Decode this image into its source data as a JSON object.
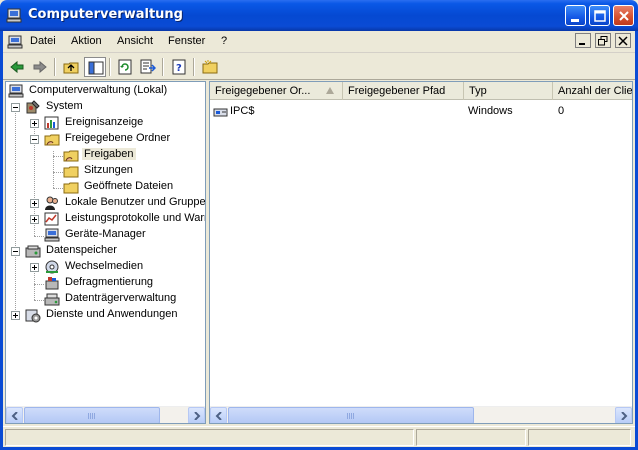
{
  "window": {
    "title": "Computerverwaltung"
  },
  "menubar": {
    "items": [
      "Datei",
      "Aktion",
      "Ansicht",
      "Fenster",
      "?"
    ]
  },
  "toolbar": {
    "buttons": [
      "back-arrow-icon",
      "forward-arrow-icon",
      "up-folder-icon",
      "show-hide-tree-icon",
      "refresh-icon",
      "export-list-icon",
      "properties-help-icon",
      "new-share-icon"
    ]
  },
  "tree": {
    "root": "Computerverwaltung (Lokal)",
    "system": "System",
    "ereignisanzeige": "Ereignisanzeige",
    "freigegebene_ordner": "Freigegebene Ordner",
    "freigaben": "Freigaben",
    "sitzungen": "Sitzungen",
    "geoeffnete_dateien": "Geöffnete Dateien",
    "lokale_benutzer": "Lokale Benutzer und Gruppen",
    "leistungsprotokolle": "Leistungsprotokolle und Warnungen",
    "geraete_manager": "Geräte-Manager",
    "datenspeicher": "Datenspeicher",
    "wechselmedien": "Wechselmedien",
    "defragmentierung": "Defragmentierung",
    "datentraegerverwaltung": "Datenträgerverwaltung",
    "dienste": "Dienste und Anwendungen"
  },
  "list": {
    "columns": [
      "Freigegebener Or...",
      "Freigegebener Pfad",
      "Typ",
      "Anzahl der Clientverbindungen"
    ],
    "rows": [
      {
        "name": "IPC$",
        "path": "",
        "type": "Windows",
        "clients": "0"
      }
    ]
  },
  "colors": {
    "titlebar": "#0a4bd4",
    "window_bg": "#ece9d8",
    "pane_border": "#7f9db9"
  }
}
